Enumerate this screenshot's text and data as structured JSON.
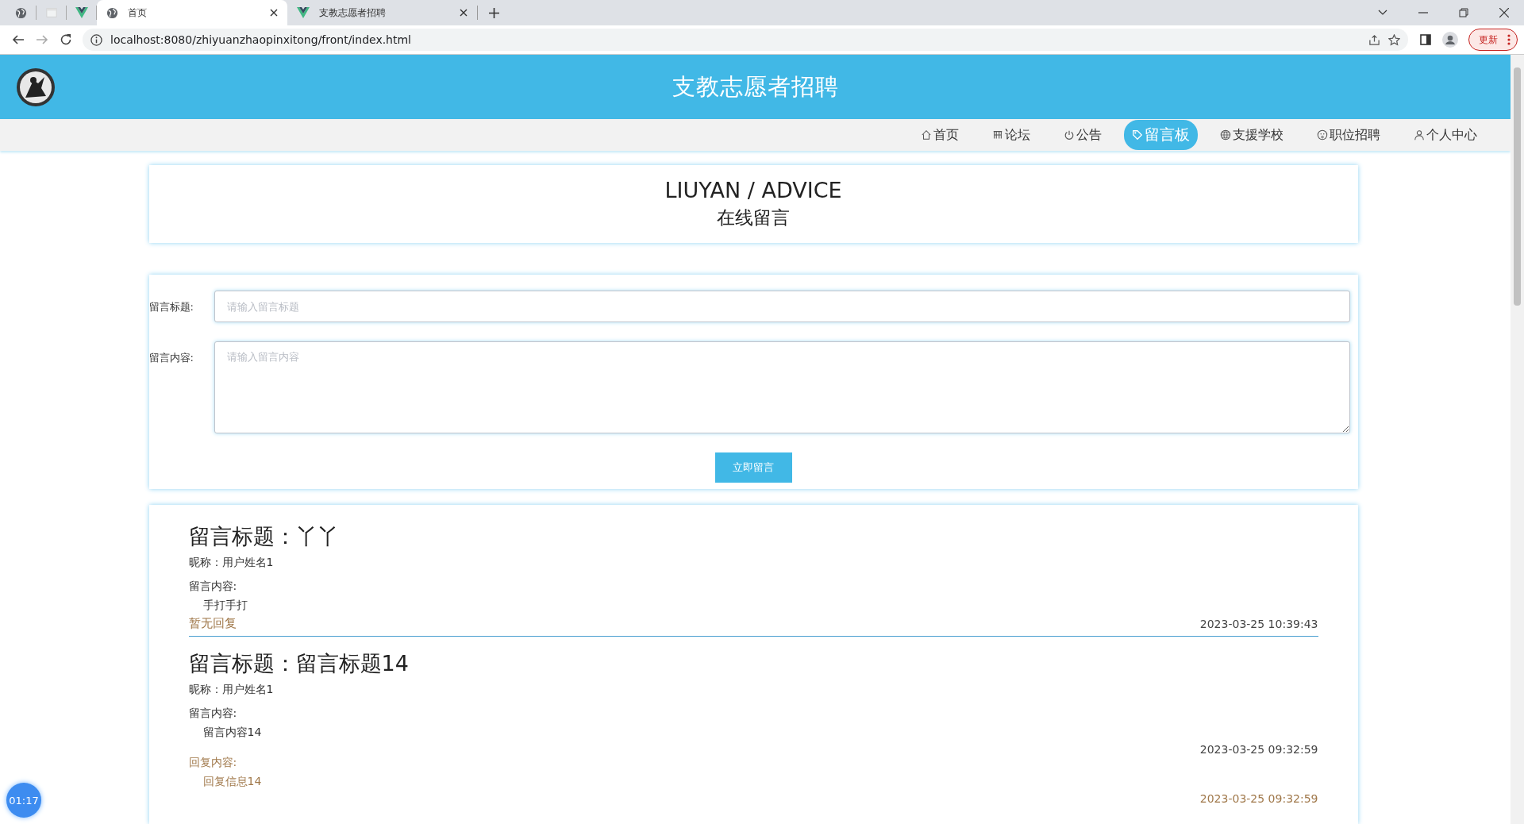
{
  "browser": {
    "tabs": [
      {
        "title": "首页",
        "selected": true
      },
      {
        "title": "支教志愿者招聘",
        "selected": false
      }
    ],
    "url": "localhost:8080/zhiyuanzhaopinxitong/front/index.html",
    "update_button": "更新"
  },
  "header": {
    "title": "支教志愿者招聘"
  },
  "nav": [
    {
      "label": "首页",
      "selected": false
    },
    {
      "label": "论坛",
      "selected": false
    },
    {
      "label": "公告",
      "selected": false
    },
    {
      "label": "留言板",
      "selected": true
    },
    {
      "label": "支援学校",
      "selected": false
    },
    {
      "label": "职位招聘",
      "selected": false
    },
    {
      "label": "个人中心",
      "selected": false
    }
  ],
  "banner": {
    "title": "LIUYAN / ADVICE",
    "subtitle": "在线留言"
  },
  "form": {
    "fields": [
      {
        "kind": "input",
        "label": "留言标题:",
        "placeholder": "请输入留言标题"
      },
      {
        "kind": "textarea",
        "label": "留言内容:",
        "placeholder": "请输入留言内容"
      }
    ],
    "submit": "立即留言"
  },
  "messages": [
    {
      "title_label": "留言标题：",
      "title": "丫丫",
      "nickname": "昵称：用户姓名1",
      "content_label": "留言内容:",
      "content": "手打手打",
      "no_reply": "暂无回复",
      "time": "2023-03-25 10:39:43"
    },
    {
      "title_label": "留言标题：",
      "title": "留言标题14",
      "nickname": "昵称：用户姓名1",
      "content_label": "留言内容:",
      "content": "留言内容14",
      "time": "2023-03-25 09:32:59",
      "reply": {
        "label": "回复内容:",
        "text": "回复信息14",
        "time": "2023-03-25 09:32:59"
      }
    }
  ],
  "timer": "01:17"
}
